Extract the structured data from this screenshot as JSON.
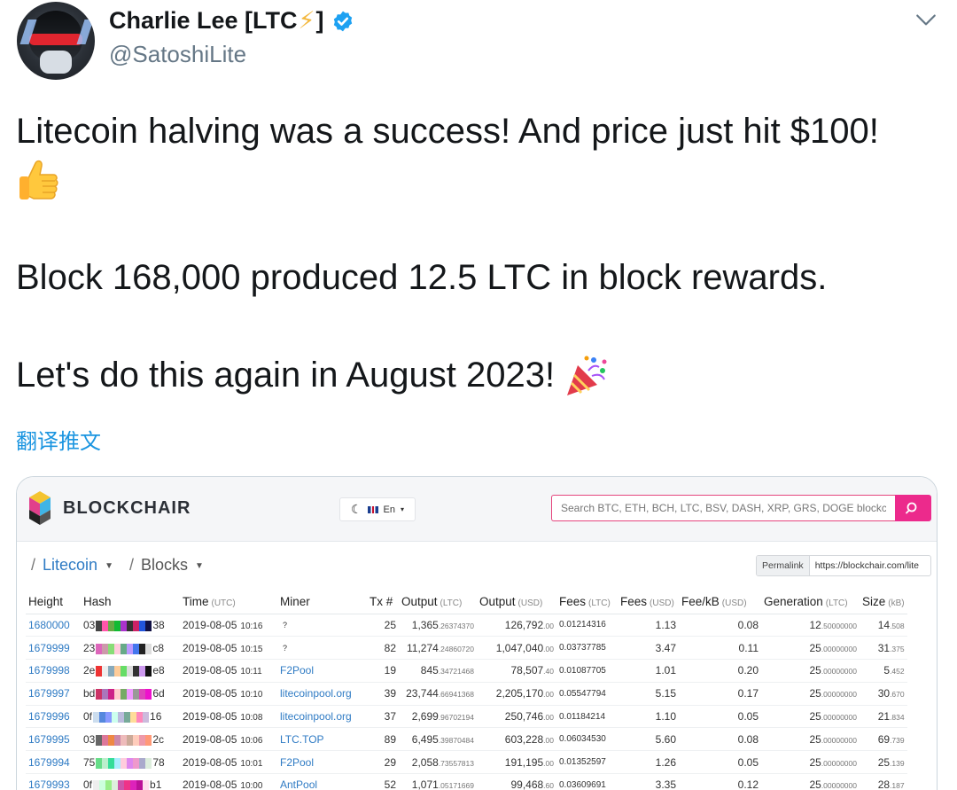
{
  "tweet": {
    "author_name": "Charlie Lee [LTC",
    "author_name_end": "]",
    "handle": "@SatoshiLite",
    "line1": "Litecoin halving was a success! And price just hit $100!",
    "line2": "Block 168,000 produced 12.5 LTC in block rewards.",
    "line3": "Let's do this again in August 2023!",
    "translate_label": "翻译推文",
    "icons": [
      "lightning-icon",
      "verified-badge-icon",
      "chevron-down-icon",
      "thumbs-up-emoji",
      "party-popper-emoji"
    ]
  },
  "blockchair": {
    "brand": "BLOCKCHAIR",
    "lang_label": "En",
    "search_placeholder": "Search BTC, ETH, BCH, LTC, BSV, DASH, XRP, GRS, DOGE blockcha",
    "crumb_coin": "Litecoin",
    "crumb_section": "Blocks",
    "permalink_label": "Permalink",
    "permalink_url": "https://blockchair.com/lite",
    "columns": [
      {
        "name": "Height",
        "unit": ""
      },
      {
        "name": "Hash",
        "unit": ""
      },
      {
        "name": "Time",
        "unit": "(UTC)"
      },
      {
        "name": "Miner",
        "unit": ""
      },
      {
        "name": "Tx #",
        "unit": ""
      },
      {
        "name": "Output",
        "unit": "(LTC)"
      },
      {
        "name": "Output",
        "unit": "(USD)"
      },
      {
        "name": "Fees",
        "unit": "(LTC)"
      },
      {
        "name": "Fees",
        "unit": "(USD)"
      },
      {
        "name": "Fee/kB",
        "unit": "(USD)"
      },
      {
        "name": "Generation",
        "unit": "(LTC)"
      },
      {
        "name": "Size",
        "unit": "(kB)"
      }
    ],
    "rows": [
      {
        "height": "1680000",
        "hash_start": "03",
        "hash_end": "38",
        "colors": [
          "#444",
          "#f5a",
          "#6a4",
          "#1b3",
          "#a3c",
          "#333",
          "#c26",
          "#25d",
          "#114"
        ],
        "time": "2019-08-05",
        "clock": "10:16",
        "miner": "?",
        "tx": "25",
        "out_ltc": "1,365",
        "out_ltc_dec": ".26374370",
        "out_usd": "126,792",
        "out_usd_dec": ".00",
        "fees_ltc": "0.01214316",
        "fees_usd": "1.13",
        "fee_kb": "0.08",
        "gen": "12",
        "gen_dec": ".50000000",
        "size": "14",
        "size_dec": ".508"
      },
      {
        "height": "1679999",
        "hash_start": "23",
        "hash_end": "c8",
        "colors": [
          "#d6b",
          "#c9a",
          "#8d7",
          "#fcd",
          "#6a8",
          "#b9f",
          "#47e",
          "#222",
          "#ddd"
        ],
        "time": "2019-08-05",
        "clock": "10:15",
        "miner": "?",
        "tx": "82",
        "out_ltc": "11,274",
        "out_ltc_dec": ".24860720",
        "out_usd": "1,047,040",
        "out_usd_dec": ".00",
        "fees_ltc": "0.03737785",
        "fees_usd": "3.47",
        "fee_kb": "0.11",
        "gen": "25",
        "gen_dec": ".00000000",
        "size": "31",
        "size_dec": ".375"
      },
      {
        "height": "1679998",
        "hash_start": "2e",
        "hash_end": "e8",
        "colors": [
          "#e33",
          "#eee",
          "#8ab",
          "#fc9",
          "#6d6",
          "#ddd",
          "#333",
          "#c9e",
          "#111"
        ],
        "time": "2019-08-05",
        "clock": "10:11",
        "miner": "F2Pool",
        "tx": "19",
        "out_ltc": "845",
        "out_ltc_dec": ".34721468",
        "out_usd": "78,507",
        "out_usd_dec": ".40",
        "fees_ltc": "0.01087705",
        "fees_usd": "1.01",
        "fee_kb": "0.20",
        "gen": "25",
        "gen_dec": ".00000000",
        "size": "5",
        "size_dec": ".452"
      },
      {
        "height": "1679997",
        "hash_start": "bd",
        "hash_end": "6d",
        "colors": [
          "#c36",
          "#a7b",
          "#c28",
          "#fcc",
          "#7a6",
          "#e9f",
          "#999",
          "#d4b",
          "#e1c"
        ],
        "time": "2019-08-05",
        "clock": "10:10",
        "miner": "litecoinpool.org",
        "tx": "39",
        "out_ltc": "23,744",
        "out_ltc_dec": ".66941368",
        "out_usd": "2,205,170",
        "out_usd_dec": ".00",
        "fees_ltc": "0.05547794",
        "fees_usd": "5.15",
        "fee_kb": "0.17",
        "gen": "25",
        "gen_dec": ".00000000",
        "size": "30",
        "size_dec": ".670"
      },
      {
        "height": "1679996",
        "hash_start": "0f",
        "hash_end": "16",
        "colors": [
          "#cde",
          "#58d",
          "#89f",
          "#cfe",
          "#bbd",
          "#7a9",
          "#fd9",
          "#f8b",
          "#cbd"
        ],
        "time": "2019-08-05",
        "clock": "10:08",
        "miner": "litecoinpool.org",
        "tx": "37",
        "out_ltc": "2,699",
        "out_ltc_dec": ".96702194",
        "out_usd": "250,746",
        "out_usd_dec": ".00",
        "fees_ltc": "0.01184214",
        "fees_usd": "1.10",
        "fee_kb": "0.05",
        "gen": "25",
        "gen_dec": ".00000000",
        "size": "21",
        "size_dec": ".834"
      },
      {
        "height": "1679995",
        "hash_start": "03",
        "hash_end": "2c",
        "colors": [
          "#666",
          "#d79",
          "#e84",
          "#c8a",
          "#ebb",
          "#ca9",
          "#fcb",
          "#e9a",
          "#f97"
        ],
        "time": "2019-08-05",
        "clock": "10:06",
        "miner": "LTC.TOP",
        "tx": "89",
        "out_ltc": "6,495",
        "out_ltc_dec": ".39870484",
        "out_usd": "603,228",
        "out_usd_dec": ".00",
        "fees_ltc": "0.06034530",
        "fees_usd": "5.60",
        "fee_kb": "0.08",
        "gen": "25",
        "gen_dec": ".00000000",
        "size": "69",
        "size_dec": ".739"
      },
      {
        "height": "1679994",
        "hash_start": "75",
        "hash_end": "78",
        "colors": [
          "#6d8",
          "#bec",
          "#3d9",
          "#aef",
          "#fcd",
          "#d8e",
          "#e9c",
          "#aac",
          "#ded"
        ],
        "time": "2019-08-05",
        "clock": "10:01",
        "miner": "F2Pool",
        "tx": "29",
        "out_ltc": "2,058",
        "out_ltc_dec": ".73557813",
        "out_usd": "191,195",
        "out_usd_dec": ".00",
        "fees_ltc": "0.01352597",
        "fees_usd": "1.26",
        "fee_kb": "0.05",
        "gen": "25",
        "gen_dec": ".00000000",
        "size": "25",
        "size_dec": ".139"
      },
      {
        "height": "1679993",
        "hash_start": "0f",
        "hash_end": "b1",
        "colors": [
          "#eee",
          "#cfd",
          "#9e8",
          "#ded",
          "#c5a",
          "#e38",
          "#d2b",
          "#b19",
          "#fde"
        ],
        "time": "2019-08-05",
        "clock": "10:00",
        "miner": "AntPool",
        "tx": "52",
        "out_ltc": "1,071",
        "out_ltc_dec": ".05171669",
        "out_usd": "99,468",
        "out_usd_dec": ".60",
        "fees_ltc": "0.03609691",
        "fees_usd": "3.35",
        "fee_kb": "0.12",
        "gen": "25",
        "gen_dec": ".00000000",
        "size": "28",
        "size_dec": ".187"
      }
    ]
  }
}
